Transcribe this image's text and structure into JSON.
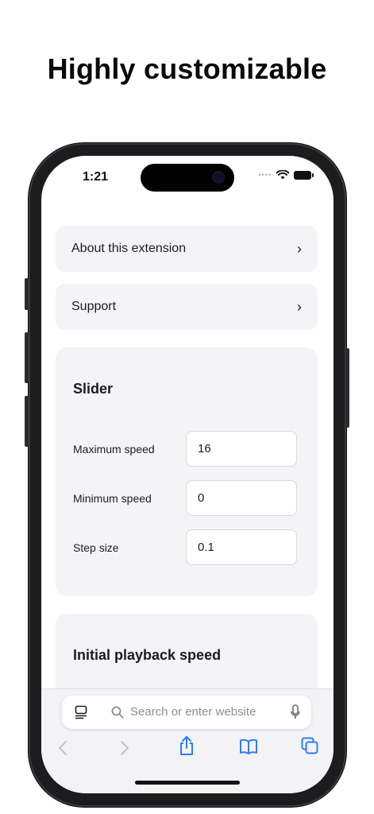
{
  "headline": "Highly customizable",
  "status": {
    "time": "1:21",
    "dots": "••••"
  },
  "menu": {
    "items": [
      {
        "label": "About this extension",
        "chevron": "›"
      },
      {
        "label": "Support",
        "chevron": "›"
      }
    ]
  },
  "slider": {
    "title": "Slider",
    "fields": [
      {
        "label": "Maximum speed",
        "value": "16"
      },
      {
        "label": "Minimum speed",
        "value": "0"
      },
      {
        "label": "Step size",
        "value": "0.1"
      }
    ]
  },
  "initial": {
    "title": "Initial playback speed"
  },
  "browser": {
    "search_placeholder": "Search or enter website",
    "icons": [
      "tabs-menu-icon",
      "search-icon",
      "mic-icon",
      "back-icon",
      "forward-icon",
      "share-icon",
      "bookmarks-icon",
      "tabs-icon"
    ]
  },
  "colors": {
    "accent": "#2f7cf6",
    "card_bg": "#f4f4f6",
    "frame": "#1c1c1e"
  }
}
